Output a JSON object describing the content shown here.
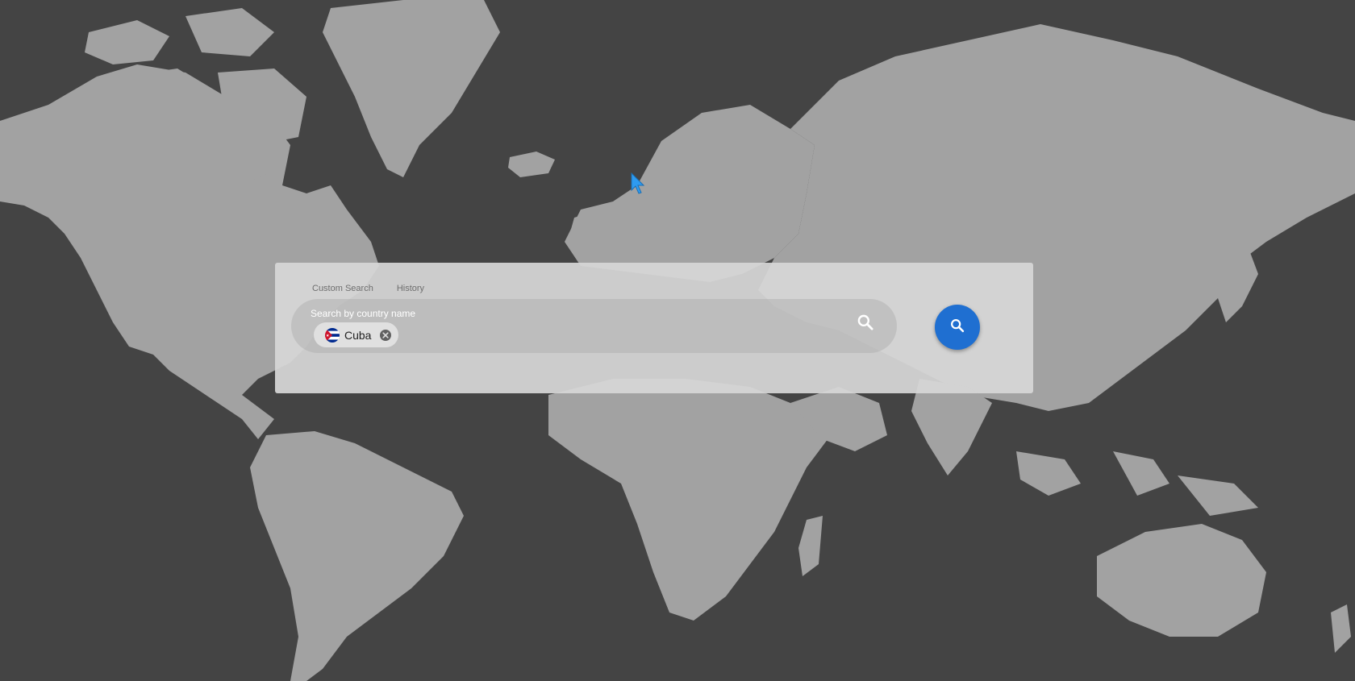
{
  "tabs": [
    {
      "label": "Custom Search"
    },
    {
      "label": "History"
    }
  ],
  "search": {
    "placeholder": "Search by country name",
    "selected_country": "Cuba",
    "flag_icon": "cuba-flag-icon",
    "remove_icon": "close-circle-icon",
    "inline_icon": "search-icon"
  },
  "fab": {
    "icon": "search-icon"
  },
  "colors": {
    "background": "#444444",
    "landmass": "#a2a2a2",
    "panel": "#d6d6d6",
    "fab": "#1f6fd1",
    "cursor": "#2e9bf0"
  }
}
